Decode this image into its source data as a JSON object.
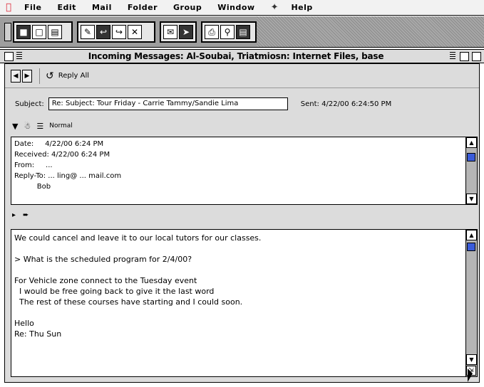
{
  "menubar": {
    "apple_icon": "apple-logo",
    "items": [
      "File",
      "Edit",
      "Mail",
      "Folder",
      "Group",
      "Window"
    ],
    "script_icon": "script-icon",
    "help": "Help"
  },
  "toolbar": {
    "groups": [
      {
        "buttons": [
          "mailbox-icon",
          "address-icon",
          "note-icon"
        ]
      },
      {
        "buttons": [
          "new-message-icon",
          "reply-icon",
          "forward-icon",
          "delete-icon"
        ]
      },
      {
        "buttons": [
          "check-mail-icon",
          "send-icon"
        ]
      },
      {
        "buttons": [
          "print-icon",
          "search-icon",
          "trash-icon"
        ]
      }
    ]
  },
  "window": {
    "title": "Incoming Messages: Al-Soubai, Triatmiosn: Internet Files, base",
    "reply_label": "Reply All",
    "subject_label": "Subject:",
    "subject_value": "Re: Subject: Tour Friday - Carrie Tammy/Sandie Lima",
    "sent_label": "Sent:",
    "sent_value": "4/22/00 6:24:50 PM",
    "icon_labels": [
      "Normal"
    ],
    "headers": "Date:     4/22/00 6:24 PM\nReceived: 4/22/00 6:24 PM\nFrom:     ...\nReply-To: ... ling@ ... mail.com\n          Bob",
    "body": "We could cancel and leave it to our local tutors for our classes.\n\n> What is the scheduled program for 2/4/00?\n\nFor Vehicle zone connect to the Tuesday event\n  I would be free going back to give it the last word\n  The rest of these courses have starting and I could soon.\n\nHello\nRe: Thu Sun"
  }
}
